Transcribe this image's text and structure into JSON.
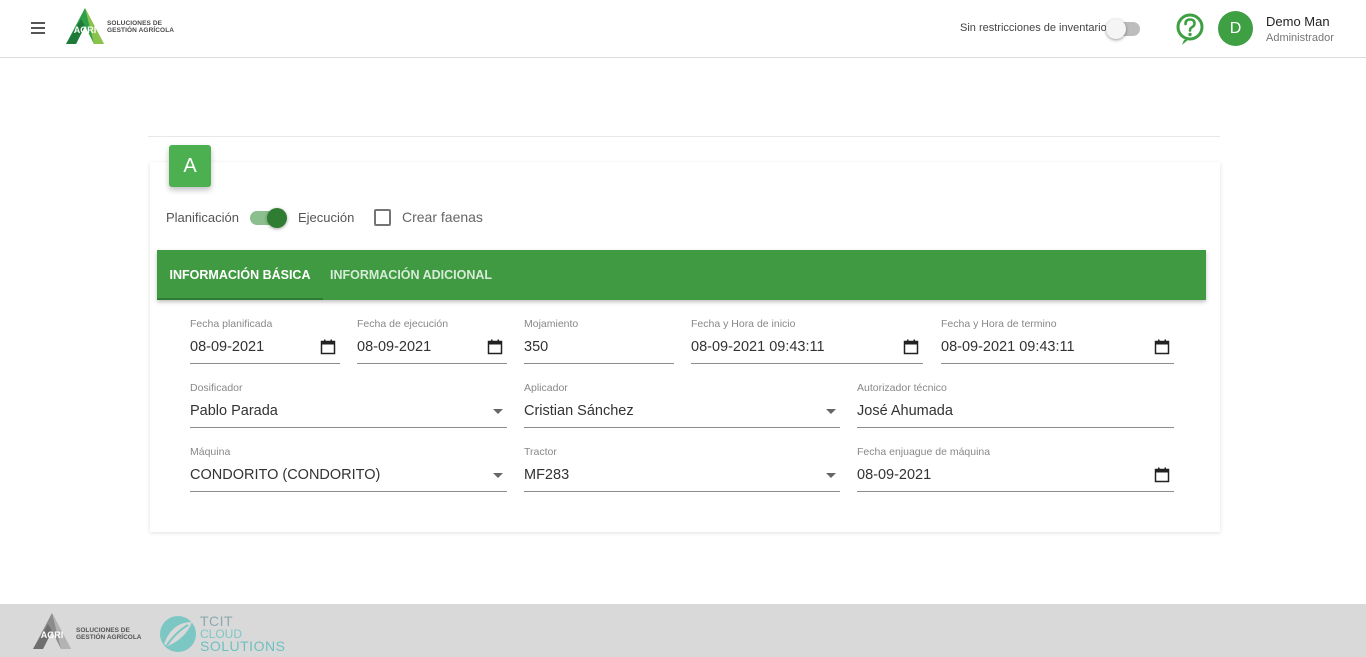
{
  "header": {
    "menu_icon": "hamburger-menu-icon",
    "logo_text_line1": "SOLUCIONES DE",
    "logo_text_line2": "GESTIÓN AGRÍCOLA",
    "logo_mark_text": "AGRI",
    "inventory_label": "Sin restricciones de inventario",
    "inventory_toggle_on": false,
    "help_icon": "help-circle-icon",
    "avatar_initial": "D",
    "user_name": "Demo Man",
    "user_role": "Administrador",
    "accent_color": "#3ea043"
  },
  "card": {
    "badge_letter": "A",
    "mode_left_label": "Planificación",
    "mode_right_label": "Ejecución",
    "mode_is_execution": true,
    "create_tasks_label": "Crear faenas",
    "create_tasks_checked": false
  },
  "tabs": [
    {
      "label": "INFORMACIÓN BÁSICA",
      "active": true
    },
    {
      "label": "INFORMACIÓN ADICIONAL",
      "active": false
    }
  ],
  "fields": {
    "fecha_planificada": {
      "label": "Fecha planificada",
      "value": "08-09-2021",
      "icon": "calendar-icon"
    },
    "fecha_ejecucion": {
      "label": "Fecha de ejecución",
      "value": "08-09-2021",
      "icon": "calendar-icon"
    },
    "mojamiento": {
      "label": "Mojamiento",
      "value": "350"
    },
    "fecha_hora_inicio": {
      "label": "Fecha y Hora de inicio",
      "value": "08-09-2021 09:43:11",
      "icon": "calendar-icon"
    },
    "fecha_hora_termino": {
      "label": "Fecha y Hora de termino",
      "value": "08-09-2021 09:43:11",
      "icon": "calendar-icon"
    },
    "dosificador": {
      "label": "Dosificador",
      "value": "Pablo Parada",
      "icon": "dropdown-caret-icon"
    },
    "aplicador": {
      "label": "Aplicador",
      "value": "Cristian Sánchez",
      "icon": "dropdown-caret-icon"
    },
    "autorizador": {
      "label": "Autorizador técnico",
      "value": "José Ahumada"
    },
    "maquina": {
      "label": "Máquina",
      "value": "CONDORITO (CONDORITO)",
      "icon": "dropdown-caret-icon"
    },
    "tractor": {
      "label": "Tractor",
      "value": "MF283",
      "icon": "dropdown-caret-icon"
    },
    "fecha_enjuague": {
      "label": "Fecha enjuague de máquina",
      "value": "08-09-2021",
      "icon": "calendar-icon"
    }
  },
  "footer": {
    "logo1_line1": "SOLUCIONES DE",
    "logo1_line2": "GESTIÓN AGRÍCOLA",
    "logo1_mark_text": "AGRI",
    "logo2_line1": "TCIT",
    "logo2_line2": "CLOUD",
    "logo2_line3": "SOLUTIONS"
  }
}
